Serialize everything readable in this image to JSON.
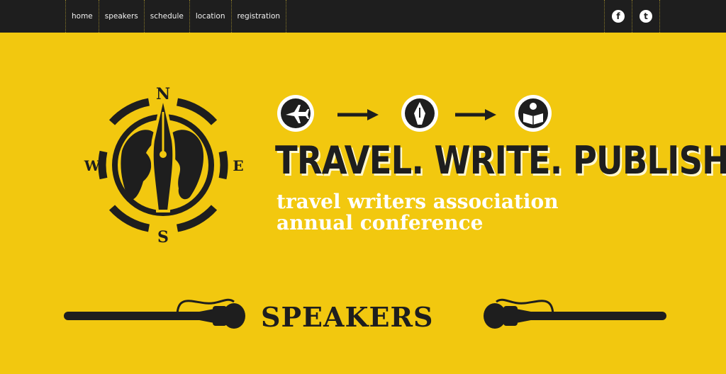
{
  "nav": {
    "items": [
      "home",
      "speakers",
      "schedule",
      "location",
      "registration"
    ]
  },
  "social": {
    "facebook_glyph": "f",
    "twitter_glyph": "t",
    "icons": [
      "facebook-icon",
      "twitter-icon"
    ]
  },
  "compass": {
    "n": "N",
    "s": "S",
    "e": "E",
    "w": "W"
  },
  "process_icons": [
    "airplane-icon",
    "arrow-right-icon",
    "pen-nib-icon",
    "arrow-right-icon",
    "reader-icon"
  ],
  "hero": {
    "headline": "TRAVEL. WRITE. PUBLISH.",
    "sub_line1": "travel writers association",
    "sub_line2": "annual conference"
  },
  "section": {
    "title": "SPEAKERS"
  },
  "colors": {
    "background": "#f2c80f",
    "bar": "#1e1e1e",
    "ink": "#1e1e1e",
    "white": "#ffffff"
  }
}
